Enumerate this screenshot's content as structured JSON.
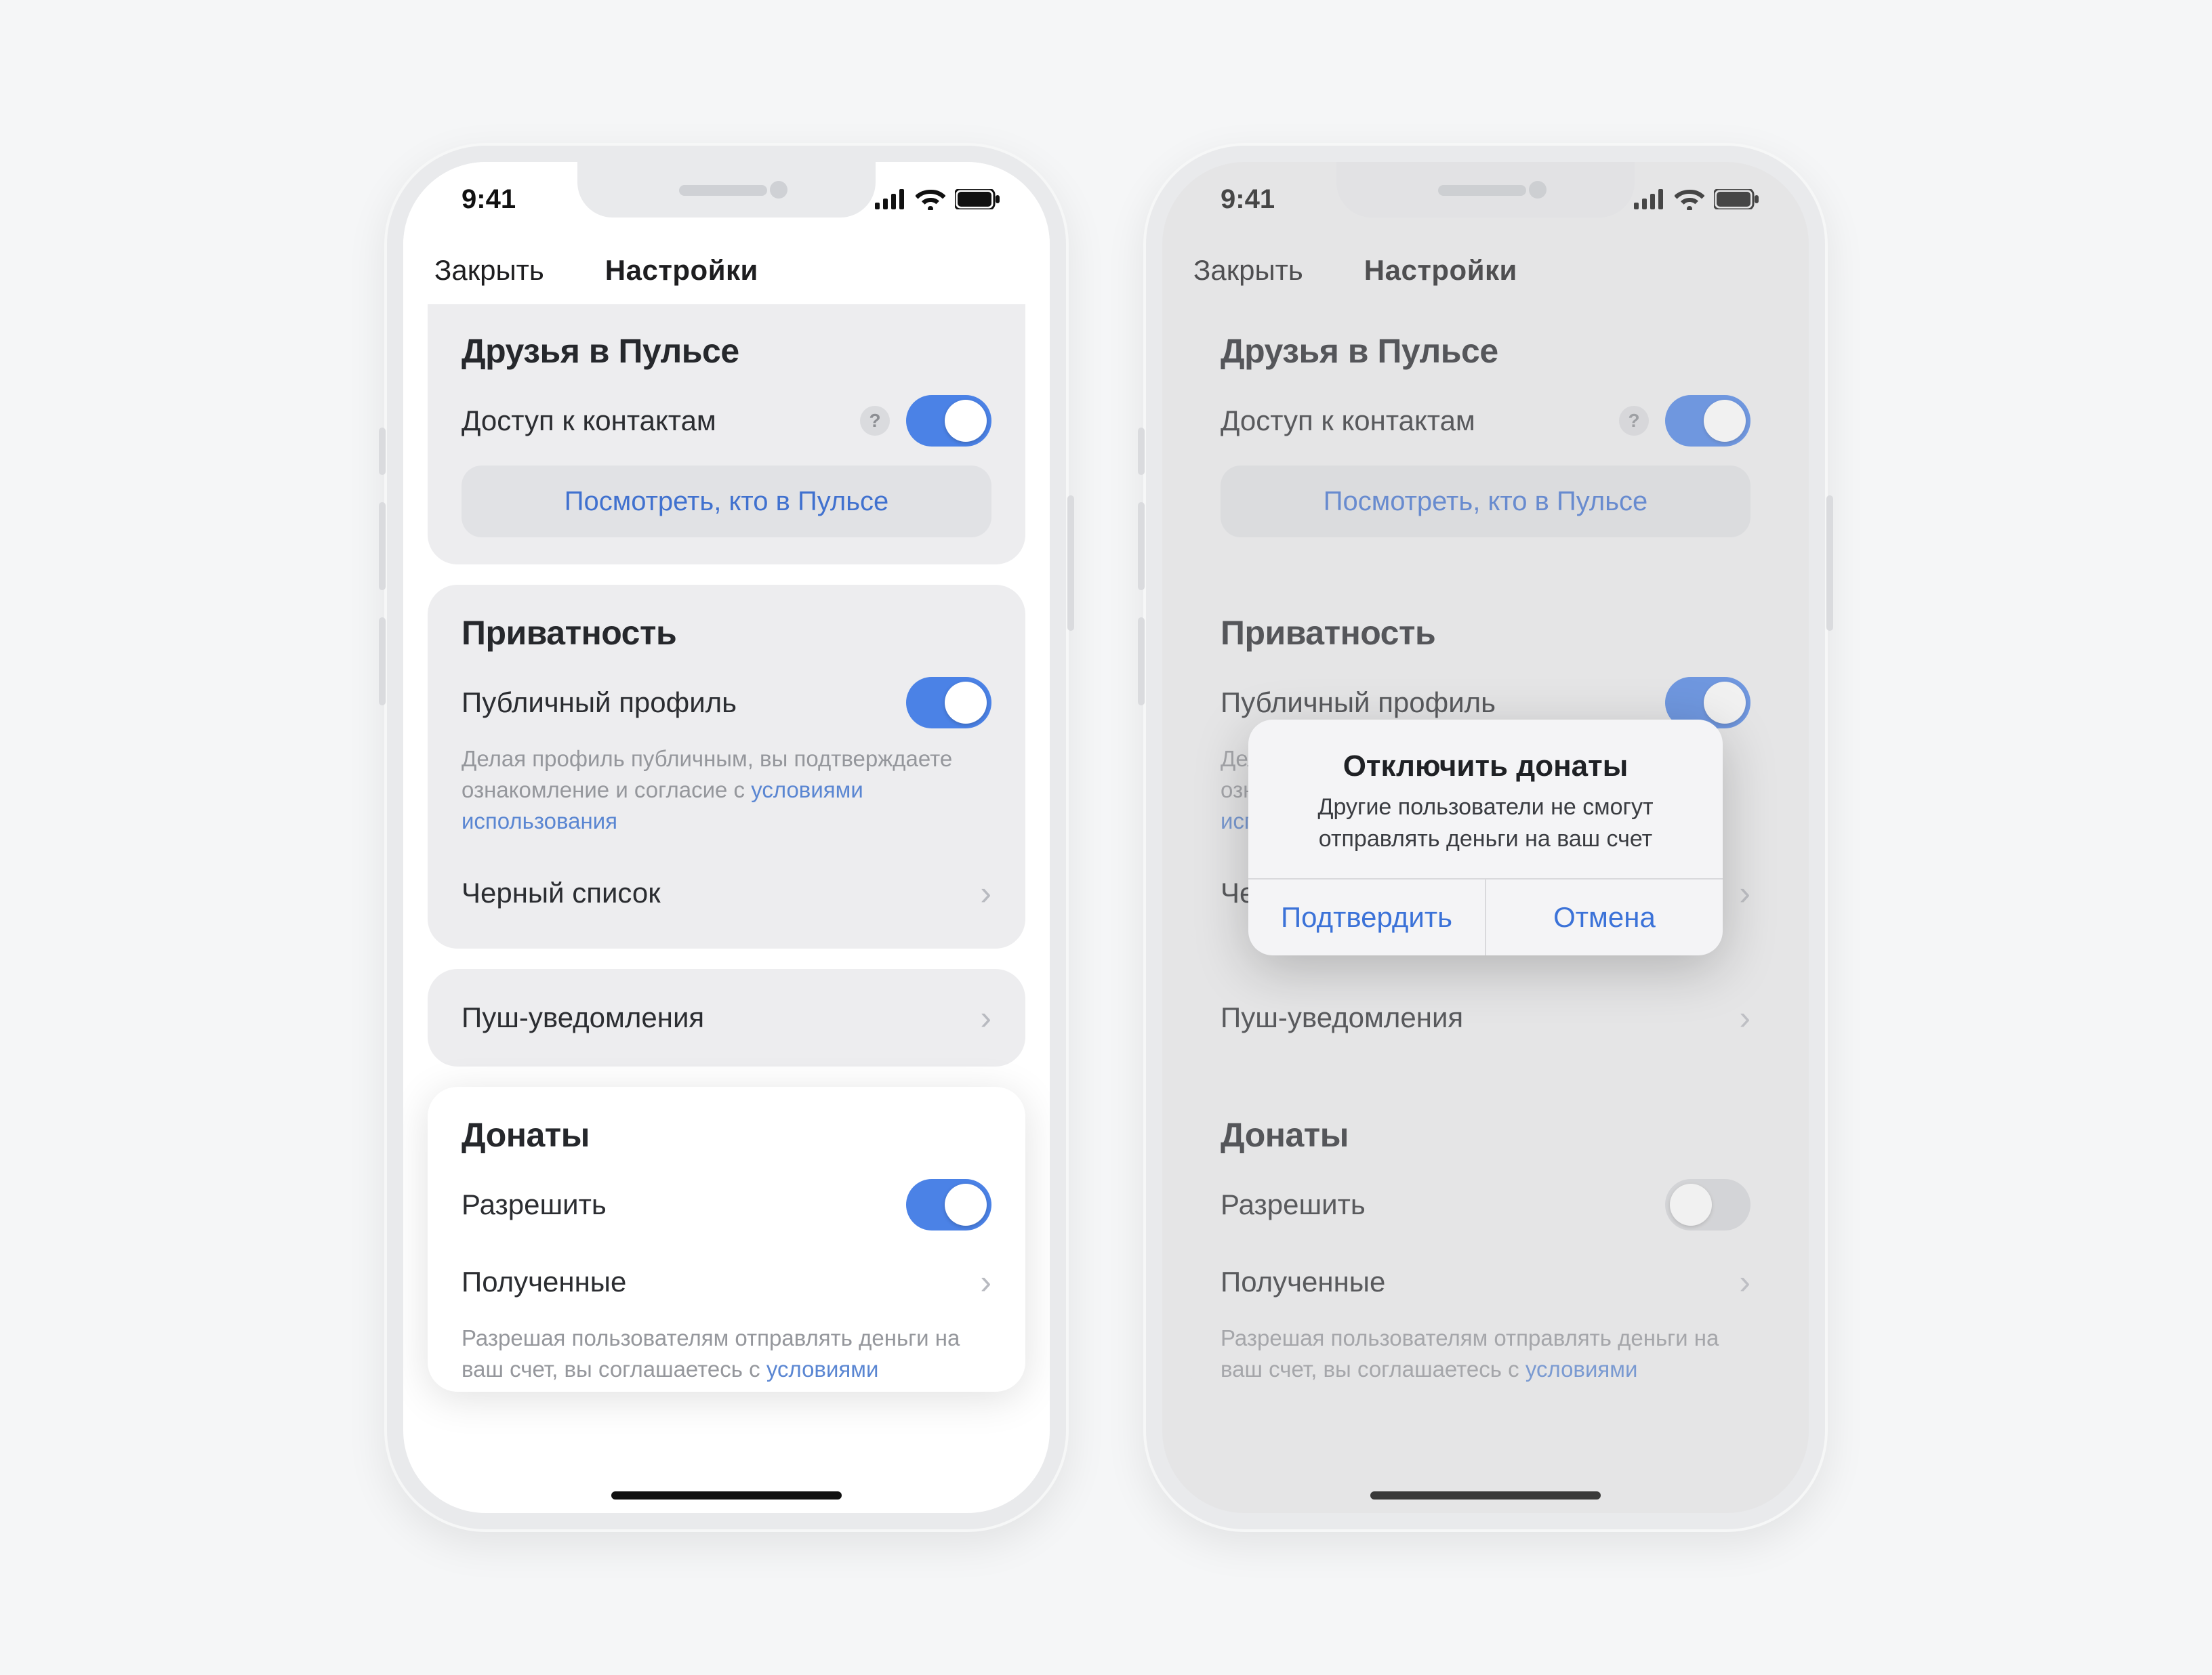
{
  "status": {
    "time": "9:41"
  },
  "nav": {
    "close": "Закрыть",
    "title": "Настройки"
  },
  "friends": {
    "title": "Друзья в Пульсе",
    "contacts_label": "Доступ к контактам",
    "view_button": "Посмотреть, кто в Пульсе"
  },
  "privacy": {
    "title": "Приватность",
    "public_profile": "Публичный профиль",
    "helper_pre": "Делая профиль публичным, вы подтверждаете ознакомление и согласие с ",
    "helper_link": "условиями использования",
    "blacklist": "Черный список"
  },
  "push": {
    "title": "Пуш-уведомления"
  },
  "donates": {
    "title": "Донаты",
    "allow": "Разрешить",
    "received": "Полученные",
    "helper_pre": "Разрешая пользователям отправлять деньги на ваш счет, вы соглашаетесь с ",
    "helper_link": "условиями"
  },
  "alert": {
    "title": "Отключить донаты",
    "message": "Другие пользователи не смогут отправлять деньги на ваш счет",
    "confirm": "Подтвердить",
    "cancel": "Отмена"
  }
}
